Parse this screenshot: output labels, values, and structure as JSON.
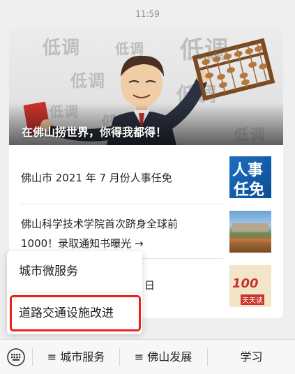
{
  "status": {
    "time": "11:59"
  },
  "hero": {
    "caption": "在佛山捞世界，你得我都得！",
    "watermark": "低调"
  },
  "news": [
    {
      "title_line1": "佛山市 2021 年 7 月份人事任免",
      "title_line2": "",
      "thumb_text_1": "人事",
      "thumb_text_2": "任免"
    },
    {
      "title_line1": "佛山科学技术学院首次跻身全球前",
      "title_line2": "1000！录取通知书曝光 →"
    },
    {
      "title_line1": "",
      "title_visible_fragment": "日",
      "thumb_text_1": "100",
      "thumb_text_2": "天天读"
    }
  ],
  "popup_menu": {
    "items": [
      "城市微服务",
      "道路交通设施改进"
    ],
    "highlight_color": "#e8231a"
  },
  "bottom_bar": {
    "menus": [
      "≡ 城市服务",
      "≡ 佛山发展",
      "学习"
    ]
  }
}
